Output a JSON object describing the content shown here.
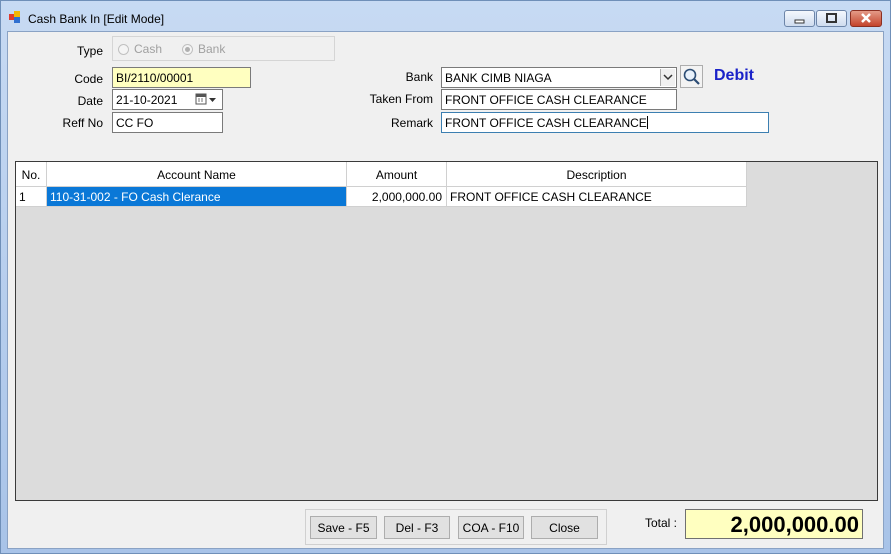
{
  "window": {
    "title": "Cash Bank In [Edit Mode]"
  },
  "form": {
    "type_label": "Type",
    "type_options": [
      "Cash",
      "Bank"
    ],
    "type_selected": "Bank",
    "code_label": "Code",
    "code_value": "BI/2110/00001",
    "date_label": "Date",
    "date_value": "21-10-2021",
    "reff_label": "Reff No",
    "reff_value": "CC FO",
    "bank_label": "Bank",
    "bank_value": "BANK CIMB NIAGA",
    "debit_label": "Debit",
    "taken_from_label": "Taken From",
    "taken_from_value": "FRONT OFFICE CASH CLEARANCE",
    "remark_label": "Remark",
    "remark_value": "FRONT OFFICE CASH CLEARANCE"
  },
  "grid": {
    "columns": [
      "No.",
      "Account Name",
      "Amount",
      "Description"
    ],
    "rows": [
      {
        "no": "1",
        "account": "110-31-002 - FO Cash Clerance",
        "amount": "2,000,000.00",
        "description": "FRONT OFFICE CASH CLEARANCE"
      }
    ]
  },
  "buttons": {
    "save": "Save - F5",
    "del": "Del - F3",
    "coa": "COA - F10",
    "close": "Close"
  },
  "total": {
    "label": "Total :",
    "value": "2,000,000.00"
  },
  "colors": {
    "selection": "#0a78d7",
    "debit": "#1a22c8",
    "highlight_field": "#ffffc0"
  },
  "icons": [
    "app-icon",
    "minimize-icon",
    "maximize-icon",
    "close-icon",
    "calendar-icon",
    "chevron-down-icon",
    "search-icon"
  ]
}
